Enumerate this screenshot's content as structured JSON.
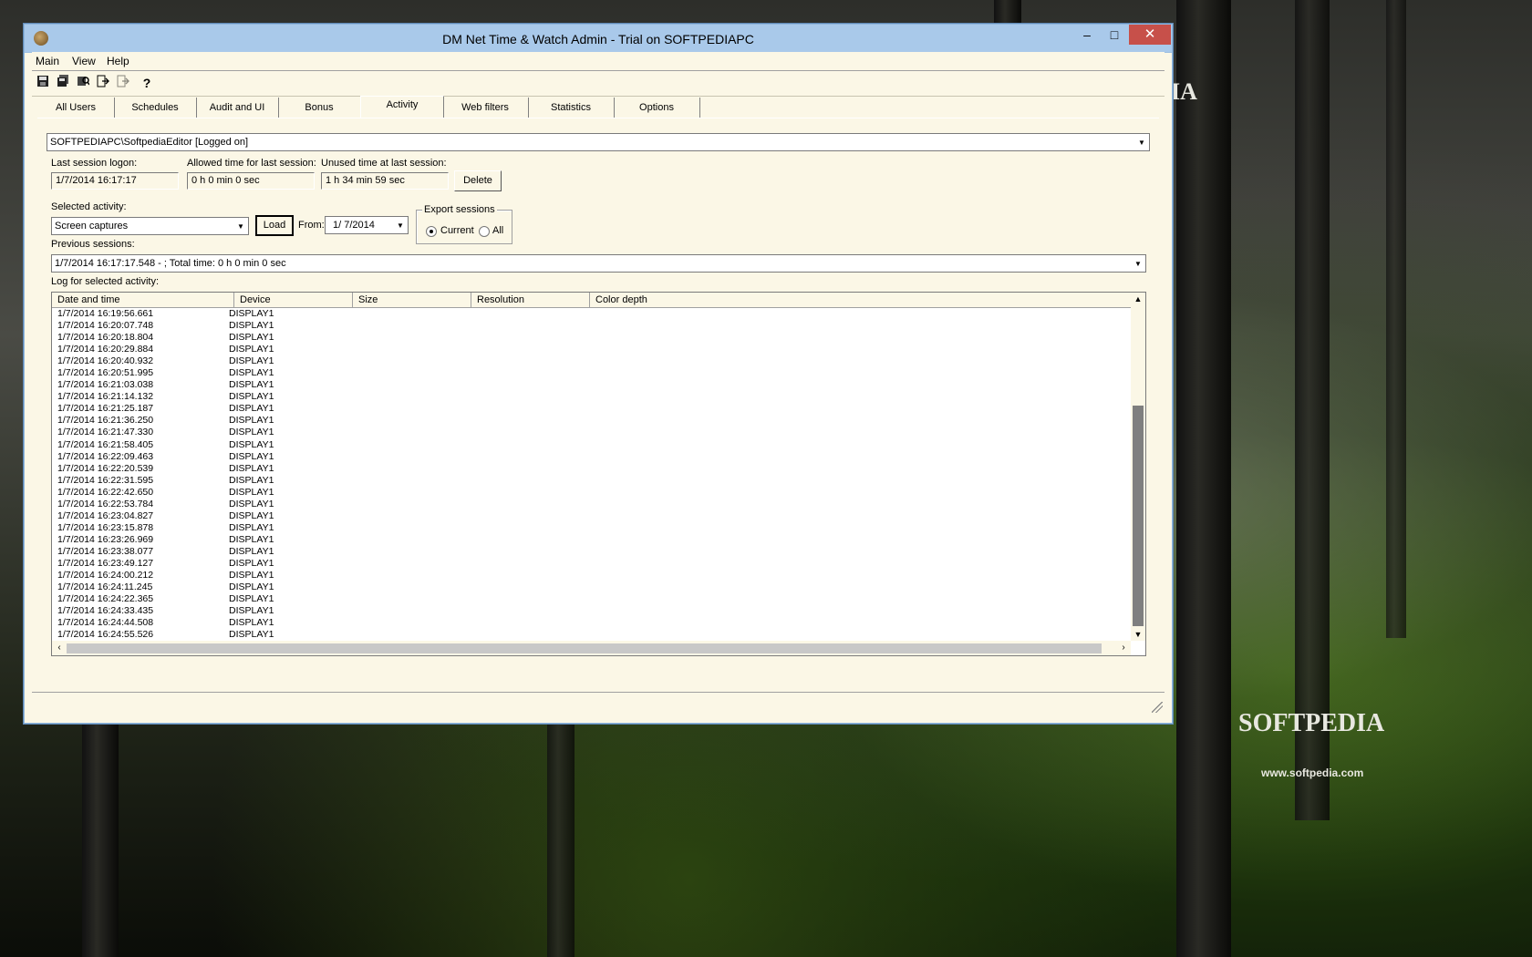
{
  "desktop": {
    "watermark_brand": "SOFTPEDIA",
    "watermark_url": "www.softpedia.com",
    "watermark_partial": "IA"
  },
  "window": {
    "title": "DM Net Time & Watch Admin - Trial on SOFTPEDIAPC",
    "controls": {
      "minimize": "–",
      "maximize": "□",
      "close": "✕"
    }
  },
  "menu": [
    "Main",
    "View",
    "Help"
  ],
  "toolbar": [
    "save-icon",
    "save-all-icon",
    "find-icon",
    "export-icon",
    "exit-icon",
    "help-icon"
  ],
  "tabs": [
    "All Users",
    "Schedules",
    "Audit and UI",
    "Bonus",
    "Activity",
    "Web filters",
    "Statistics",
    "Options"
  ],
  "active_tab": "Activity",
  "user_select": {
    "value": "SOFTPEDIAPC\\SoftpediaEditor  [Logged on]"
  },
  "session": {
    "last_logon_label": "Last session logon:",
    "last_logon_value": "1/7/2014 16:17:17",
    "allowed_label": "Allowed time for last session:",
    "allowed_value": "0 h 0 min 0 sec",
    "unused_label": "Unused time at last session:",
    "unused_value": "1 h 34 min 59 sec",
    "delete_label": "Delete"
  },
  "activity": {
    "selected_label": "Selected activity:",
    "selected_value": "Screen captures",
    "load_label": "Load",
    "from_label": "From:",
    "from_value": "1/  7/2014"
  },
  "export": {
    "legend": "Export sessions",
    "current_label": "Current",
    "all_label": "All",
    "selected": "current"
  },
  "previous": {
    "label": "Previous sessions:",
    "value": "1/7/2014 16:17:17.548 - ;  Total time:  0 h 0 min 0 sec"
  },
  "log": {
    "label": "Log for selected activity:",
    "columns": [
      "Date and time",
      "Device",
      "Size",
      "Resolution",
      "Color depth"
    ],
    "rows": [
      [
        "1/7/2014 16:19:56.661",
        "DISPLAY1"
      ],
      [
        "1/7/2014 16:20:07.748",
        "DISPLAY1"
      ],
      [
        "1/7/2014 16:20:18.804",
        "DISPLAY1"
      ],
      [
        "1/7/2014 16:20:29.884",
        "DISPLAY1"
      ],
      [
        "1/7/2014 16:20:40.932",
        "DISPLAY1"
      ],
      [
        "1/7/2014 16:20:51.995",
        "DISPLAY1"
      ],
      [
        "1/7/2014 16:21:03.038",
        "DISPLAY1"
      ],
      [
        "1/7/2014 16:21:14.132",
        "DISPLAY1"
      ],
      [
        "1/7/2014 16:21:25.187",
        "DISPLAY1"
      ],
      [
        "1/7/2014 16:21:36.250",
        "DISPLAY1"
      ],
      [
        "1/7/2014 16:21:47.330",
        "DISPLAY1"
      ],
      [
        "1/7/2014 16:21:58.405",
        "DISPLAY1"
      ],
      [
        "1/7/2014 16:22:09.463",
        "DISPLAY1"
      ],
      [
        "1/7/2014 16:22:20.539",
        "DISPLAY1"
      ],
      [
        "1/7/2014 16:22:31.595",
        "DISPLAY1"
      ],
      [
        "1/7/2014 16:22:42.650",
        "DISPLAY1"
      ],
      [
        "1/7/2014 16:22:53.784",
        "DISPLAY1"
      ],
      [
        "1/7/2014 16:23:04.827",
        "DISPLAY1"
      ],
      [
        "1/7/2014 16:23:15.878",
        "DISPLAY1"
      ],
      [
        "1/7/2014 16:23:26.969",
        "DISPLAY1"
      ],
      [
        "1/7/2014 16:23:38.077",
        "DISPLAY1"
      ],
      [
        "1/7/2014 16:23:49.127",
        "DISPLAY1"
      ],
      [
        "1/7/2014 16:24:00.212",
        "DISPLAY1"
      ],
      [
        "1/7/2014 16:24:11.245",
        "DISPLAY1"
      ],
      [
        "1/7/2014 16:24:22.365",
        "DISPLAY1"
      ],
      [
        "1/7/2014 16:24:33.435",
        "DISPLAY1"
      ],
      [
        "1/7/2014 16:24:44.508",
        "DISPLAY1"
      ],
      [
        "1/7/2014 16:24:55.526",
        "DISPLAY1"
      ]
    ]
  },
  "colors": {
    "title_bar": "#a9c9ea",
    "close_button": "#c7504a",
    "window_bg": "#fbf7e6"
  }
}
